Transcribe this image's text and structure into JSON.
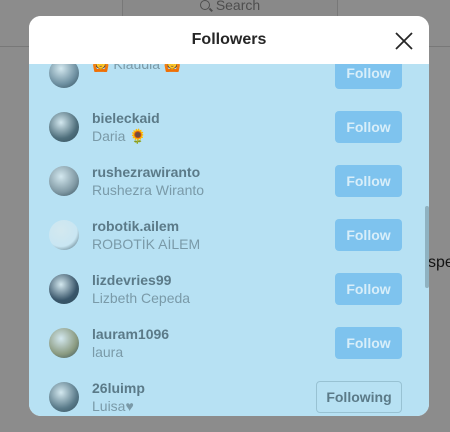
{
  "background": {
    "search_placeholder": "Search",
    "side_text": "spe"
  },
  "modal": {
    "title": "Followers",
    "close_icon": "close-icon"
  },
  "followers": [
    {
      "username": "",
      "fullname": "🙆 Klaudia 🙆",
      "button": "Follow",
      "state": "follow",
      "avatar_color": "#6d8fa0"
    },
    {
      "username": "bieleckaid",
      "fullname": "Daria 🌻",
      "button": "Follow",
      "state": "follow",
      "avatar_color": "#4f6f7c"
    },
    {
      "username": "rushezrawiranto",
      "fullname": "Rushezra Wiranto",
      "button": "Follow",
      "state": "follow",
      "avatar_color": "#7f98a3"
    },
    {
      "username": "robotik.ailem",
      "fullname": "ROBOTİK AİLEM",
      "button": "Follow",
      "state": "follow",
      "avatar_color": "#c9e6f2"
    },
    {
      "username": "lizdevries99",
      "fullname": "Lizbeth Cepeda",
      "button": "Follow",
      "state": "follow",
      "avatar_color": "#39566a"
    },
    {
      "username": "lauram1096",
      "fullname": "laura",
      "button": "Follow",
      "state": "follow",
      "avatar_color": "#8a9a80"
    },
    {
      "username": "26luimp",
      "fullname": "Luisa♥",
      "button": "Following",
      "state": "following",
      "avatar_color": "#5a7b8a"
    }
  ]
}
